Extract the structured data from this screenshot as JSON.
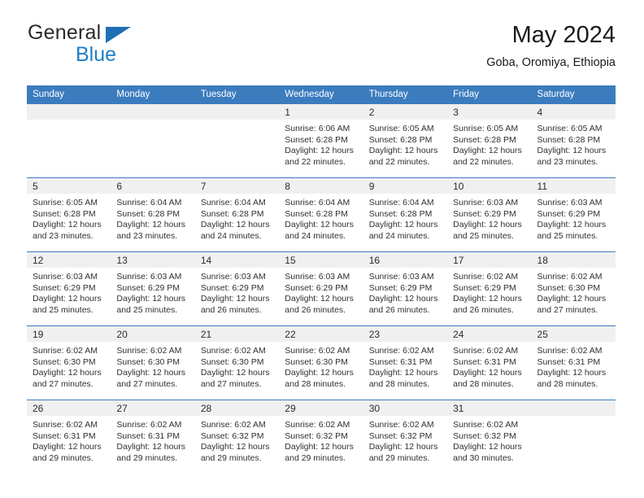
{
  "brand": {
    "name_part1": "General",
    "name_part2": "Blue",
    "triangle_color": "#1f6fb5",
    "blue_color": "#1f7ec4"
  },
  "header": {
    "title": "May 2024",
    "subtitle": "Goba, Oromiya, Ethiopia",
    "accent_color": "#3b7cbf"
  },
  "weekday_headers": [
    "Sunday",
    "Monday",
    "Tuesday",
    "Wednesday",
    "Thursday",
    "Friday",
    "Saturday"
  ],
  "weeks": [
    [
      {
        "day": "",
        "sunrise": "",
        "sunset": "",
        "daylight_line1": "",
        "daylight_line2": ""
      },
      {
        "day": "",
        "sunrise": "",
        "sunset": "",
        "daylight_line1": "",
        "daylight_line2": ""
      },
      {
        "day": "",
        "sunrise": "",
        "sunset": "",
        "daylight_line1": "",
        "daylight_line2": ""
      },
      {
        "day": "1",
        "sunrise": "Sunrise: 6:06 AM",
        "sunset": "Sunset: 6:28 PM",
        "daylight_line1": "Daylight: 12 hours",
        "daylight_line2": "and 22 minutes."
      },
      {
        "day": "2",
        "sunrise": "Sunrise: 6:05 AM",
        "sunset": "Sunset: 6:28 PM",
        "daylight_line1": "Daylight: 12 hours",
        "daylight_line2": "and 22 minutes."
      },
      {
        "day": "3",
        "sunrise": "Sunrise: 6:05 AM",
        "sunset": "Sunset: 6:28 PM",
        "daylight_line1": "Daylight: 12 hours",
        "daylight_line2": "and 22 minutes."
      },
      {
        "day": "4",
        "sunrise": "Sunrise: 6:05 AM",
        "sunset": "Sunset: 6:28 PM",
        "daylight_line1": "Daylight: 12 hours",
        "daylight_line2": "and 23 minutes."
      }
    ],
    [
      {
        "day": "5",
        "sunrise": "Sunrise: 6:05 AM",
        "sunset": "Sunset: 6:28 PM",
        "daylight_line1": "Daylight: 12 hours",
        "daylight_line2": "and 23 minutes."
      },
      {
        "day": "6",
        "sunrise": "Sunrise: 6:04 AM",
        "sunset": "Sunset: 6:28 PM",
        "daylight_line1": "Daylight: 12 hours",
        "daylight_line2": "and 23 minutes."
      },
      {
        "day": "7",
        "sunrise": "Sunrise: 6:04 AM",
        "sunset": "Sunset: 6:28 PM",
        "daylight_line1": "Daylight: 12 hours",
        "daylight_line2": "and 24 minutes."
      },
      {
        "day": "8",
        "sunrise": "Sunrise: 6:04 AM",
        "sunset": "Sunset: 6:28 PM",
        "daylight_line1": "Daylight: 12 hours",
        "daylight_line2": "and 24 minutes."
      },
      {
        "day": "9",
        "sunrise": "Sunrise: 6:04 AM",
        "sunset": "Sunset: 6:28 PM",
        "daylight_line1": "Daylight: 12 hours",
        "daylight_line2": "and 24 minutes."
      },
      {
        "day": "10",
        "sunrise": "Sunrise: 6:03 AM",
        "sunset": "Sunset: 6:29 PM",
        "daylight_line1": "Daylight: 12 hours",
        "daylight_line2": "and 25 minutes."
      },
      {
        "day": "11",
        "sunrise": "Sunrise: 6:03 AM",
        "sunset": "Sunset: 6:29 PM",
        "daylight_line1": "Daylight: 12 hours",
        "daylight_line2": "and 25 minutes."
      }
    ],
    [
      {
        "day": "12",
        "sunrise": "Sunrise: 6:03 AM",
        "sunset": "Sunset: 6:29 PM",
        "daylight_line1": "Daylight: 12 hours",
        "daylight_line2": "and 25 minutes."
      },
      {
        "day": "13",
        "sunrise": "Sunrise: 6:03 AM",
        "sunset": "Sunset: 6:29 PM",
        "daylight_line1": "Daylight: 12 hours",
        "daylight_line2": "and 25 minutes."
      },
      {
        "day": "14",
        "sunrise": "Sunrise: 6:03 AM",
        "sunset": "Sunset: 6:29 PM",
        "daylight_line1": "Daylight: 12 hours",
        "daylight_line2": "and 26 minutes."
      },
      {
        "day": "15",
        "sunrise": "Sunrise: 6:03 AM",
        "sunset": "Sunset: 6:29 PM",
        "daylight_line1": "Daylight: 12 hours",
        "daylight_line2": "and 26 minutes."
      },
      {
        "day": "16",
        "sunrise": "Sunrise: 6:03 AM",
        "sunset": "Sunset: 6:29 PM",
        "daylight_line1": "Daylight: 12 hours",
        "daylight_line2": "and 26 minutes."
      },
      {
        "day": "17",
        "sunrise": "Sunrise: 6:02 AM",
        "sunset": "Sunset: 6:29 PM",
        "daylight_line1": "Daylight: 12 hours",
        "daylight_line2": "and 26 minutes."
      },
      {
        "day": "18",
        "sunrise": "Sunrise: 6:02 AM",
        "sunset": "Sunset: 6:30 PM",
        "daylight_line1": "Daylight: 12 hours",
        "daylight_line2": "and 27 minutes."
      }
    ],
    [
      {
        "day": "19",
        "sunrise": "Sunrise: 6:02 AM",
        "sunset": "Sunset: 6:30 PM",
        "daylight_line1": "Daylight: 12 hours",
        "daylight_line2": "and 27 minutes."
      },
      {
        "day": "20",
        "sunrise": "Sunrise: 6:02 AM",
        "sunset": "Sunset: 6:30 PM",
        "daylight_line1": "Daylight: 12 hours",
        "daylight_line2": "and 27 minutes."
      },
      {
        "day": "21",
        "sunrise": "Sunrise: 6:02 AM",
        "sunset": "Sunset: 6:30 PM",
        "daylight_line1": "Daylight: 12 hours",
        "daylight_line2": "and 27 minutes."
      },
      {
        "day": "22",
        "sunrise": "Sunrise: 6:02 AM",
        "sunset": "Sunset: 6:30 PM",
        "daylight_line1": "Daylight: 12 hours",
        "daylight_line2": "and 28 minutes."
      },
      {
        "day": "23",
        "sunrise": "Sunrise: 6:02 AM",
        "sunset": "Sunset: 6:31 PM",
        "daylight_line1": "Daylight: 12 hours",
        "daylight_line2": "and 28 minutes."
      },
      {
        "day": "24",
        "sunrise": "Sunrise: 6:02 AM",
        "sunset": "Sunset: 6:31 PM",
        "daylight_line1": "Daylight: 12 hours",
        "daylight_line2": "and 28 minutes."
      },
      {
        "day": "25",
        "sunrise": "Sunrise: 6:02 AM",
        "sunset": "Sunset: 6:31 PM",
        "daylight_line1": "Daylight: 12 hours",
        "daylight_line2": "and 28 minutes."
      }
    ],
    [
      {
        "day": "26",
        "sunrise": "Sunrise: 6:02 AM",
        "sunset": "Sunset: 6:31 PM",
        "daylight_line1": "Daylight: 12 hours",
        "daylight_line2": "and 29 minutes."
      },
      {
        "day": "27",
        "sunrise": "Sunrise: 6:02 AM",
        "sunset": "Sunset: 6:31 PM",
        "daylight_line1": "Daylight: 12 hours",
        "daylight_line2": "and 29 minutes."
      },
      {
        "day": "28",
        "sunrise": "Sunrise: 6:02 AM",
        "sunset": "Sunset: 6:32 PM",
        "daylight_line1": "Daylight: 12 hours",
        "daylight_line2": "and 29 minutes."
      },
      {
        "day": "29",
        "sunrise": "Sunrise: 6:02 AM",
        "sunset": "Sunset: 6:32 PM",
        "daylight_line1": "Daylight: 12 hours",
        "daylight_line2": "and 29 minutes."
      },
      {
        "day": "30",
        "sunrise": "Sunrise: 6:02 AM",
        "sunset": "Sunset: 6:32 PM",
        "daylight_line1": "Daylight: 12 hours",
        "daylight_line2": "and 29 minutes."
      },
      {
        "day": "31",
        "sunrise": "Sunrise: 6:02 AM",
        "sunset": "Sunset: 6:32 PM",
        "daylight_line1": "Daylight: 12 hours",
        "daylight_line2": "and 30 minutes."
      },
      {
        "day": "",
        "sunrise": "",
        "sunset": "",
        "daylight_line1": "",
        "daylight_line2": ""
      }
    ]
  ]
}
